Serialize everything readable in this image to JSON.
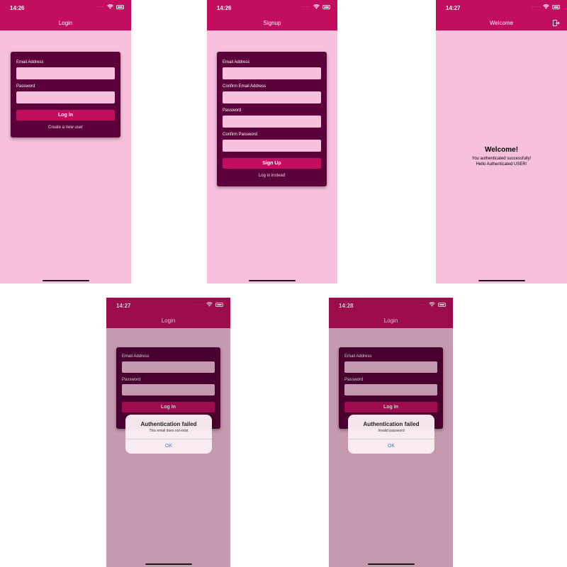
{
  "screens": {
    "login": {
      "time": "14:26",
      "title": "Login",
      "email_label": "Email Address",
      "password_label": "Password",
      "login_button": "Log In",
      "create_link": "Create a new user"
    },
    "signup": {
      "time": "14:26",
      "title": "Signup",
      "email_label": "Email Address",
      "confirm_email_label": "Confirm Email Address",
      "password_label": "Password",
      "confirm_password_label": "Confirm Password",
      "signup_button": "Sign Up",
      "login_link": "Log in instead"
    },
    "welcome": {
      "time": "14:27",
      "title": "Welcome",
      "heading": "Welcome!",
      "line1": "You authenticated successfully!",
      "line2": "Hello Authenticated USER!",
      "logout_icon": "logout-icon"
    },
    "error_email": {
      "time": "14:27",
      "title": "Login",
      "email_label": "Email Address",
      "password_label": "Password",
      "login_button": "Log In",
      "alert_title": "Authentication failed",
      "alert_message": "This email does not exist",
      "alert_ok": "OK"
    },
    "error_password": {
      "time": "14:28",
      "title": "Login",
      "email_label": "Email Address",
      "password_label": "Password",
      "login_button": "Log In",
      "alert_title": "Authentication failed",
      "alert_message": "Invalid password",
      "alert_ok": "OK"
    }
  },
  "colors": {
    "primary": "#c30e60",
    "card": "#5b003a",
    "background": "#f7c0dc",
    "alert_button": "#2f7cf6"
  }
}
